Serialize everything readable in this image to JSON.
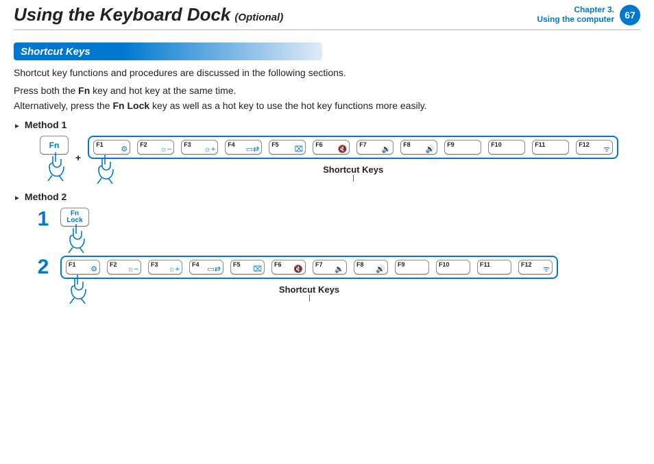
{
  "header": {
    "title": "Using the Keyboard Dock",
    "optional": "(Optional)",
    "chapter_line1": "Chapter 3.",
    "chapter_line2": "Using the computer",
    "page_number": "67"
  },
  "section": {
    "title": "Shortcut Keys"
  },
  "intro": "Shortcut key functions and procedures are discussed in the following sections.",
  "instr1_pre": "Press both the ",
  "instr1_bold": "Fn",
  "instr1_post": " key and hot key at the same time.",
  "instr2_pre": "Alternatively, press the ",
  "instr2_bold": "Fn Lock",
  "instr2_post": " key as well as a hot key to use the hot key functions more easily.",
  "method1_label": "Method 1",
  "method2_label": "Method 2",
  "fn_key": "Fn",
  "fnlock_key": "Fn Lock",
  "plus": "+",
  "step1": "1",
  "step2": "2",
  "caption": "Shortcut Keys",
  "fkeys": [
    {
      "label": "F1",
      "icon": "⚙"
    },
    {
      "label": "F2",
      "icon": "☼−"
    },
    {
      "label": "F3",
      "icon": "☼+"
    },
    {
      "label": "F4",
      "icon": "▭⇄"
    },
    {
      "label": "F5",
      "icon": "⌧"
    },
    {
      "label": "F6",
      "icon": "🔇"
    },
    {
      "label": "F7",
      "icon": "🔉"
    },
    {
      "label": "F8",
      "icon": "🔊"
    },
    {
      "label": "F9",
      "icon": ""
    },
    {
      "label": "F10",
      "icon": ""
    },
    {
      "label": "F11",
      "icon": ""
    },
    {
      "label": "F12",
      "icon": "ᯤ"
    }
  ]
}
